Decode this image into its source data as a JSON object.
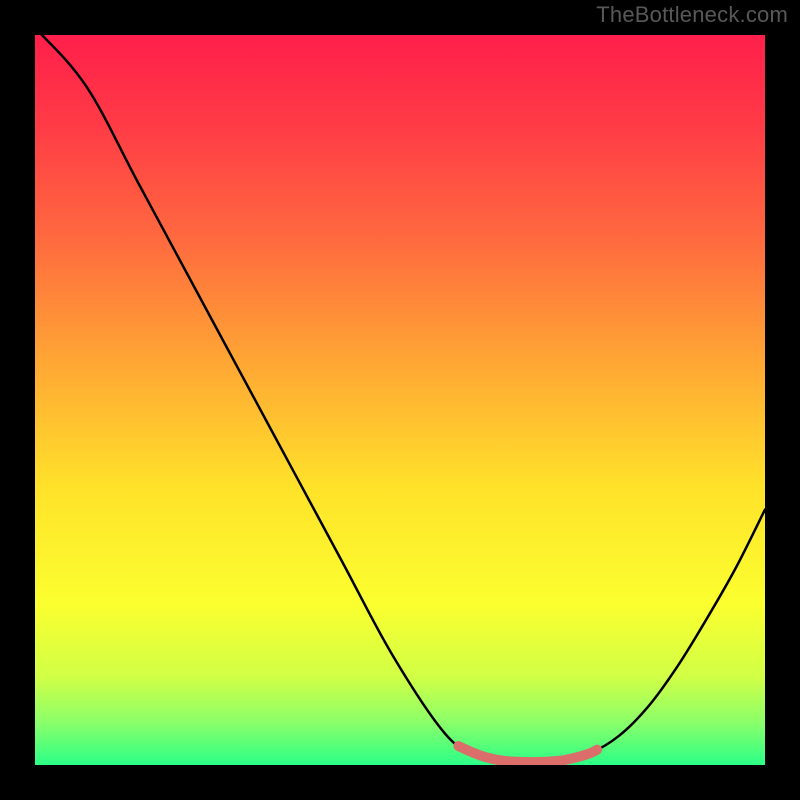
{
  "watermark": "TheBottleneck.com",
  "chart_data": {
    "type": "line",
    "title": "",
    "xlabel": "",
    "ylabel": "",
    "xlim": [
      0,
      100
    ],
    "ylim": [
      0,
      100
    ],
    "series": [
      {
        "name": "curve",
        "color": "#000000",
        "x": [
          0,
          7,
          14,
          21,
          28,
          35,
          42,
          49,
          56,
          60,
          64,
          68,
          72,
          76,
          80,
          84,
          88,
          92,
          96,
          100
        ],
        "values": [
          101,
          93,
          80,
          67,
          54,
          41,
          28,
          15,
          4.5,
          1.7,
          0.6,
          0.4,
          0.6,
          1.6,
          4.0,
          8.0,
          13.5,
          20,
          27,
          35
        ]
      },
      {
        "name": "bottleneck-region",
        "color": "#db6e6b",
        "x": [
          58,
          60,
          62,
          64,
          66,
          68,
          70,
          72,
          74,
          76,
          77
        ],
        "values": [
          2.6,
          1.7,
          1.0,
          0.6,
          0.45,
          0.4,
          0.45,
          0.6,
          1.0,
          1.6,
          2.1
        ]
      }
    ],
    "gradient": {
      "stops": [
        {
          "offset": 0.0,
          "color": "#ff1f4b"
        },
        {
          "offset": 0.12,
          "color": "#ff3a46"
        },
        {
          "offset": 0.28,
          "color": "#ff6a3f"
        },
        {
          "offset": 0.45,
          "color": "#ffa734"
        },
        {
          "offset": 0.62,
          "color": "#ffe22a"
        },
        {
          "offset": 0.78,
          "color": "#fbff2f"
        },
        {
          "offset": 0.88,
          "color": "#d0ff46"
        },
        {
          "offset": 0.94,
          "color": "#8dff68"
        },
        {
          "offset": 1.0,
          "color": "#2bff87"
        }
      ]
    }
  }
}
